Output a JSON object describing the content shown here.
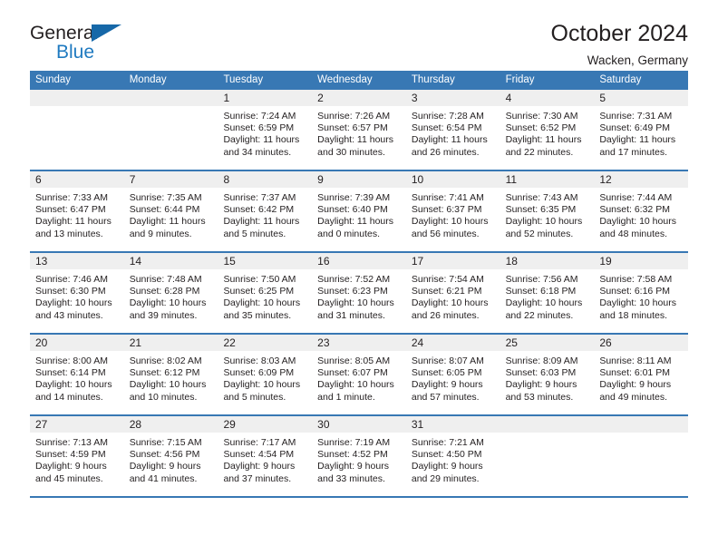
{
  "brand": {
    "name_top": "General",
    "name_bottom": "Blue",
    "triangle_color": "#1668a8",
    "blue_color": "#1f7ac0"
  },
  "header": {
    "title": "October 2024",
    "subtitle": "Wacken, Germany"
  },
  "theme": {
    "header_bar": "#3878b4",
    "date_band": "#efefef",
    "week_divider": "#3878b4",
    "text": "#231f20"
  },
  "calendar": {
    "weekday_headers": [
      "Sunday",
      "Monday",
      "Tuesday",
      "Wednesday",
      "Thursday",
      "Friday",
      "Saturday"
    ],
    "weeks": [
      [
        {
          "day": "",
          "lines": []
        },
        {
          "day": "",
          "lines": []
        },
        {
          "day": "1",
          "lines": [
            "Sunrise: 7:24 AM",
            "Sunset: 6:59 PM",
            "Daylight: 11 hours",
            "and 34 minutes."
          ]
        },
        {
          "day": "2",
          "lines": [
            "Sunrise: 7:26 AM",
            "Sunset: 6:57 PM",
            "Daylight: 11 hours",
            "and 30 minutes."
          ]
        },
        {
          "day": "3",
          "lines": [
            "Sunrise: 7:28 AM",
            "Sunset: 6:54 PM",
            "Daylight: 11 hours",
            "and 26 minutes."
          ]
        },
        {
          "day": "4",
          "lines": [
            "Sunrise: 7:30 AM",
            "Sunset: 6:52 PM",
            "Daylight: 11 hours",
            "and 22 minutes."
          ]
        },
        {
          "day": "5",
          "lines": [
            "Sunrise: 7:31 AM",
            "Sunset: 6:49 PM",
            "Daylight: 11 hours",
            "and 17 minutes."
          ]
        }
      ],
      [
        {
          "day": "6",
          "lines": [
            "Sunrise: 7:33 AM",
            "Sunset: 6:47 PM",
            "Daylight: 11 hours",
            "and 13 minutes."
          ]
        },
        {
          "day": "7",
          "lines": [
            "Sunrise: 7:35 AM",
            "Sunset: 6:44 PM",
            "Daylight: 11 hours",
            "and 9 minutes."
          ]
        },
        {
          "day": "8",
          "lines": [
            "Sunrise: 7:37 AM",
            "Sunset: 6:42 PM",
            "Daylight: 11 hours",
            "and 5 minutes."
          ]
        },
        {
          "day": "9",
          "lines": [
            "Sunrise: 7:39 AM",
            "Sunset: 6:40 PM",
            "Daylight: 11 hours",
            "and 0 minutes."
          ]
        },
        {
          "day": "10",
          "lines": [
            "Sunrise: 7:41 AM",
            "Sunset: 6:37 PM",
            "Daylight: 10 hours",
            "and 56 minutes."
          ]
        },
        {
          "day": "11",
          "lines": [
            "Sunrise: 7:43 AM",
            "Sunset: 6:35 PM",
            "Daylight: 10 hours",
            "and 52 minutes."
          ]
        },
        {
          "day": "12",
          "lines": [
            "Sunrise: 7:44 AM",
            "Sunset: 6:32 PM",
            "Daylight: 10 hours",
            "and 48 minutes."
          ]
        }
      ],
      [
        {
          "day": "13",
          "lines": [
            "Sunrise: 7:46 AM",
            "Sunset: 6:30 PM",
            "Daylight: 10 hours",
            "and 43 minutes."
          ]
        },
        {
          "day": "14",
          "lines": [
            "Sunrise: 7:48 AM",
            "Sunset: 6:28 PM",
            "Daylight: 10 hours",
            "and 39 minutes."
          ]
        },
        {
          "day": "15",
          "lines": [
            "Sunrise: 7:50 AM",
            "Sunset: 6:25 PM",
            "Daylight: 10 hours",
            "and 35 minutes."
          ]
        },
        {
          "day": "16",
          "lines": [
            "Sunrise: 7:52 AM",
            "Sunset: 6:23 PM",
            "Daylight: 10 hours",
            "and 31 minutes."
          ]
        },
        {
          "day": "17",
          "lines": [
            "Sunrise: 7:54 AM",
            "Sunset: 6:21 PM",
            "Daylight: 10 hours",
            "and 26 minutes."
          ]
        },
        {
          "day": "18",
          "lines": [
            "Sunrise: 7:56 AM",
            "Sunset: 6:18 PM",
            "Daylight: 10 hours",
            "and 22 minutes."
          ]
        },
        {
          "day": "19",
          "lines": [
            "Sunrise: 7:58 AM",
            "Sunset: 6:16 PM",
            "Daylight: 10 hours",
            "and 18 minutes."
          ]
        }
      ],
      [
        {
          "day": "20",
          "lines": [
            "Sunrise: 8:00 AM",
            "Sunset: 6:14 PM",
            "Daylight: 10 hours",
            "and 14 minutes."
          ]
        },
        {
          "day": "21",
          "lines": [
            "Sunrise: 8:02 AM",
            "Sunset: 6:12 PM",
            "Daylight: 10 hours",
            "and 10 minutes."
          ]
        },
        {
          "day": "22",
          "lines": [
            "Sunrise: 8:03 AM",
            "Sunset: 6:09 PM",
            "Daylight: 10 hours",
            "and 5 minutes."
          ]
        },
        {
          "day": "23",
          "lines": [
            "Sunrise: 8:05 AM",
            "Sunset: 6:07 PM",
            "Daylight: 10 hours",
            "and 1 minute."
          ]
        },
        {
          "day": "24",
          "lines": [
            "Sunrise: 8:07 AM",
            "Sunset: 6:05 PM",
            "Daylight: 9 hours",
            "and 57 minutes."
          ]
        },
        {
          "day": "25",
          "lines": [
            "Sunrise: 8:09 AM",
            "Sunset: 6:03 PM",
            "Daylight: 9 hours",
            "and 53 minutes."
          ]
        },
        {
          "day": "26",
          "lines": [
            "Sunrise: 8:11 AM",
            "Sunset: 6:01 PM",
            "Daylight: 9 hours",
            "and 49 minutes."
          ]
        }
      ],
      [
        {
          "day": "27",
          "lines": [
            "Sunrise: 7:13 AM",
            "Sunset: 4:59 PM",
            "Daylight: 9 hours",
            "and 45 minutes."
          ]
        },
        {
          "day": "28",
          "lines": [
            "Sunrise: 7:15 AM",
            "Sunset: 4:56 PM",
            "Daylight: 9 hours",
            "and 41 minutes."
          ]
        },
        {
          "day": "29",
          "lines": [
            "Sunrise: 7:17 AM",
            "Sunset: 4:54 PM",
            "Daylight: 9 hours",
            "and 37 minutes."
          ]
        },
        {
          "day": "30",
          "lines": [
            "Sunrise: 7:19 AM",
            "Sunset: 4:52 PM",
            "Daylight: 9 hours",
            "and 33 minutes."
          ]
        },
        {
          "day": "31",
          "lines": [
            "Sunrise: 7:21 AM",
            "Sunset: 4:50 PM",
            "Daylight: 9 hours",
            "and 29 minutes."
          ]
        },
        {
          "day": "",
          "lines": []
        },
        {
          "day": "",
          "lines": []
        }
      ]
    ]
  }
}
